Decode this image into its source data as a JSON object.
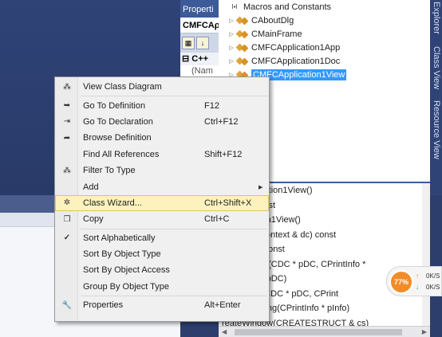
{
  "properties": {
    "title": "Properti",
    "object": "CMFCAρ",
    "category": "C++",
    "row": "(Nam"
  },
  "class_view": {
    "items": [
      {
        "label": "Macros and Constants",
        "icon": "macro-icon"
      },
      {
        "label": "CAboutDlg",
        "icon": "class-icon"
      },
      {
        "label": "CMainFrame",
        "icon": "class-icon"
      },
      {
        "label": "CMFCApplication1App",
        "icon": "class-icon"
      },
      {
        "label": "CMFCApplication1Doc",
        "icon": "class-icon"
      },
      {
        "label": "CMFCApplication1View",
        "icon": "class-icon",
        "selected": true
      }
    ]
  },
  "vertical_tabs": [
    "Explorer",
    "Class View",
    "Resource View"
  ],
  "members": [
    "CFCApplication1View()",
    "rtValid() const",
    "CApplication1View()",
    "p(CDumpContext & dc) const",
    "ocument() const",
    "eginPrinting(CDC * pDC, CPrintInfo *",
    "raw(CDC * pDC)",
    "ndPrinting(CDC * pDC, CPrint",
    "reparePrinting(CPrintInfo * pInfo)",
    "reateWindow(CREATESTRUCT & cs)"
  ],
  "speed_widget": {
    "percent": "77%",
    "up": "0K/S",
    "down": "0K/S",
    "up_color": "#ee7b21",
    "down_color": "#2aa44a"
  },
  "context_menu": {
    "items": [
      {
        "type": "item",
        "label": "View Class Diagram",
        "shortcut": "",
        "icon": "class-diagram-icon"
      },
      {
        "type": "separator"
      },
      {
        "type": "item",
        "label": "Go To Definition",
        "shortcut": "F12",
        "icon": "go-to-definition-icon"
      },
      {
        "type": "item",
        "label": "Go To Declaration",
        "shortcut": "Ctrl+F12",
        "icon": "go-to-declaration-icon"
      },
      {
        "type": "item",
        "label": "Browse Definition",
        "shortcut": "",
        "icon": "browse-definition-icon"
      },
      {
        "type": "item",
        "label": "Find All References",
        "shortcut": "Shift+F12",
        "icon": ""
      },
      {
        "type": "item",
        "label": "Filter To Type",
        "shortcut": "",
        "icon": "filter-type-icon"
      },
      {
        "type": "item",
        "label": "Add",
        "shortcut": "",
        "icon": "",
        "submenu": true
      },
      {
        "type": "item",
        "label": "Class Wizard...",
        "shortcut": "Ctrl+Shift+X",
        "icon": "class-wizard-icon",
        "highlighted": true
      },
      {
        "type": "item",
        "label": "Copy",
        "shortcut": "Ctrl+C",
        "icon": "copy-icon"
      },
      {
        "type": "separator"
      },
      {
        "type": "item",
        "label": "Sort Alphabetically",
        "shortcut": "",
        "icon": "checkmark-icon"
      },
      {
        "type": "item",
        "label": "Sort By Object Type",
        "shortcut": "",
        "icon": ""
      },
      {
        "type": "item",
        "label": "Sort By Object Access",
        "shortcut": "",
        "icon": ""
      },
      {
        "type": "item",
        "label": "Group By Object Type",
        "shortcut": "",
        "icon": ""
      },
      {
        "type": "separator"
      },
      {
        "type": "item",
        "label": "Properties",
        "shortcut": "Alt+Enter",
        "icon": "wrench-icon"
      }
    ]
  }
}
